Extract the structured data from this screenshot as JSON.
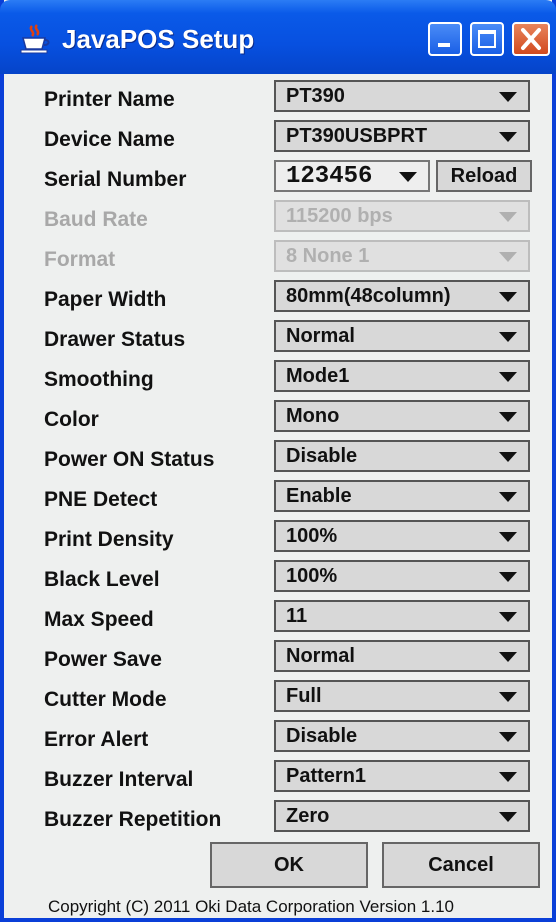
{
  "window": {
    "title": "JavaPOS Setup",
    "icon": "java-cup-icon"
  },
  "fields": [
    {
      "label": "Printer Name",
      "value": "PT390",
      "enabled": true
    },
    {
      "label": "Device Name",
      "value": "PT390USBPRT",
      "enabled": true
    },
    {
      "label": "Serial Number",
      "value": "123456",
      "enabled": true,
      "button": "Reload"
    },
    {
      "label": "Baud Rate",
      "value": "115200 bps",
      "enabled": false
    },
    {
      "label": "Format",
      "value": "8 None 1",
      "enabled": false
    },
    {
      "label": "Paper Width",
      "value": "80mm(48column)",
      "enabled": true
    },
    {
      "label": "Drawer Status",
      "value": "Normal",
      "enabled": true
    },
    {
      "label": "Smoothing",
      "value": "Mode1",
      "enabled": true
    },
    {
      "label": "Color",
      "value": "Mono",
      "enabled": true
    },
    {
      "label": "Power ON Status",
      "value": "Disable",
      "enabled": true
    },
    {
      "label": "PNE Detect",
      "value": "Enable",
      "enabled": true
    },
    {
      "label": "Print Density",
      "value": "100%",
      "enabled": true
    },
    {
      "label": "Black Level",
      "value": "100%",
      "enabled": true
    },
    {
      "label": "Max Speed",
      "value": "11",
      "enabled": true
    },
    {
      "label": "Power Save",
      "value": "Normal",
      "enabled": true
    },
    {
      "label": "Cutter Mode",
      "value": "Full",
      "enabled": true
    },
    {
      "label": "Error Alert",
      "value": "Disable",
      "enabled": true
    },
    {
      "label": "Buzzer Interval",
      "value": "Pattern1",
      "enabled": true
    },
    {
      "label": "Buzzer Repetition",
      "value": "Zero",
      "enabled": true
    }
  ],
  "buttons": {
    "ok": "OK",
    "cancel": "Cancel"
  },
  "footer": {
    "copyright": "Copyright (C) 2011 Oki Data Corporation Version 1.10"
  },
  "colors": {
    "titlebar": "#0750e0",
    "close_button": "#d24a1f",
    "dialog_bg": "#eef0ef"
  }
}
